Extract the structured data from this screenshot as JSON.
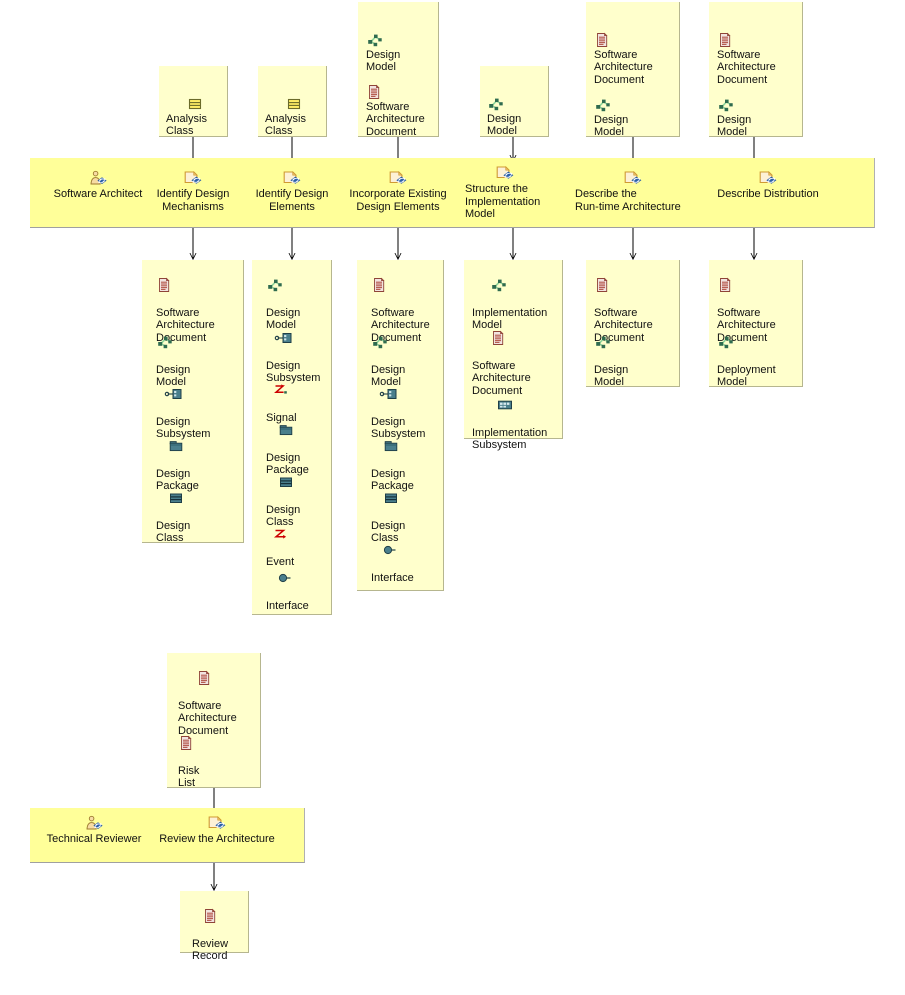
{
  "diagram": {
    "title": "Analysis & Design: Define a Candidate Architecture / Refine the Architecture (activity diagram)",
    "colors": {
      "band_fill": "#ffff99",
      "box_fill": "#ffffcc",
      "box_border": "#b6b68f",
      "connector": "#000000",
      "document_icon": "#c4756b",
      "model_icon": "#2f6b4f",
      "uml_teal": "#4a7f8c",
      "signal_red": "#cc0000",
      "task_tan": "#e8b96a",
      "role_blue": "#2a5fa8"
    },
    "roles": [
      {
        "id": "software-architect",
        "label": "Software Architect",
        "icon": "role-icon"
      },
      {
        "id": "technical-reviewer",
        "label": "Technical Reviewer",
        "icon": "role-icon"
      }
    ],
    "tasks": [
      {
        "id": "identify-design-mechanisms",
        "label": "Identify Design\nMechanisms",
        "icon": "task-icon"
      },
      {
        "id": "identify-design-elements",
        "label": "Identify Design\nElements",
        "icon": "task-icon"
      },
      {
        "id": "incorporate-existing-design-elements",
        "label": "Incorporate Existing\nDesign Elements",
        "icon": "task-icon"
      },
      {
        "id": "structure-the-implementation-model",
        "label": "Structure the\nImplementation\nModel",
        "icon": "task-icon"
      },
      {
        "id": "describe-the-run-time-architecture",
        "label": "Describe the\nRun-time Architecture",
        "icon": "task-icon"
      },
      {
        "id": "describe-distribution",
        "label": "Describe Distribution",
        "icon": "task-icon"
      },
      {
        "id": "review-the-architecture",
        "label": "Review the Architecture",
        "icon": "task-icon"
      }
    ],
    "input_boxes": [
      {
        "id": "input-identify-design-mechanisms",
        "artifacts": [
          {
            "icon": "analysis-class-icon",
            "label": "Analysis\nClass"
          }
        ]
      },
      {
        "id": "input-identify-design-elements",
        "artifacts": [
          {
            "icon": "analysis-class-icon",
            "label": "Analysis\nClass"
          }
        ]
      },
      {
        "id": "input-incorporate-existing-design-elements",
        "artifacts": [
          {
            "icon": "model-icon",
            "label": "Design\nModel"
          },
          {
            "icon": "document-icon",
            "label": "Software\nArchitecture\nDocument"
          }
        ]
      },
      {
        "id": "input-structure-the-implementation-model",
        "artifacts": [
          {
            "icon": "model-icon",
            "label": "Design\nModel"
          }
        ]
      },
      {
        "id": "input-describe-the-run-time-architecture",
        "artifacts": [
          {
            "icon": "document-icon",
            "label": "Software\nArchitecture\nDocument"
          },
          {
            "icon": "model-icon",
            "label": "Design\nModel"
          }
        ]
      },
      {
        "id": "input-describe-distribution",
        "artifacts": [
          {
            "icon": "document-icon",
            "label": "Software\nArchitecture\nDocument"
          },
          {
            "icon": "model-icon",
            "label": "Design\nModel"
          }
        ]
      },
      {
        "id": "input-review-the-architecture",
        "artifacts": [
          {
            "icon": "document-icon",
            "label": "Software\nArchitecture\nDocument"
          },
          {
            "icon": "document-icon",
            "label": "Risk\nList"
          }
        ]
      }
    ],
    "output_boxes": [
      {
        "id": "output-identify-design-mechanisms",
        "artifacts": [
          {
            "icon": "document-icon",
            "label": "Software\nArchitecture\nDocument"
          },
          {
            "icon": "model-icon",
            "label": "Design\nModel"
          },
          {
            "icon": "subsystem-icon",
            "label": "Design\nSubsystem"
          },
          {
            "icon": "package-icon",
            "label": "Design\nPackage"
          },
          {
            "icon": "class-icon",
            "label": "Design\nClass"
          }
        ]
      },
      {
        "id": "output-identify-design-elements",
        "artifacts": [
          {
            "icon": "model-icon",
            "label": "Design\nModel"
          },
          {
            "icon": "subsystem-icon",
            "label": "Design\nSubsystem"
          },
          {
            "icon": "signal-icon",
            "label": "Signal"
          },
          {
            "icon": "package-icon",
            "label": "Design\nPackage"
          },
          {
            "icon": "class-icon",
            "label": "Design\nClass"
          },
          {
            "icon": "event-icon",
            "label": "Event"
          },
          {
            "icon": "interface-icon",
            "label": "Interface"
          }
        ]
      },
      {
        "id": "output-incorporate-existing-design-elements",
        "artifacts": [
          {
            "icon": "document-icon",
            "label": "Software\nArchitecture\nDocument"
          },
          {
            "icon": "model-icon",
            "label": "Design\nModel"
          },
          {
            "icon": "subsystem-icon",
            "label": "Design\nSubsystem"
          },
          {
            "icon": "package-icon",
            "label": "Design\nPackage"
          },
          {
            "icon": "class-icon",
            "label": "Design\nClass"
          },
          {
            "icon": "interface-icon",
            "label": "Interface"
          }
        ]
      },
      {
        "id": "output-structure-the-implementation-model",
        "artifacts": [
          {
            "icon": "model-icon",
            "label": "Implementation\nModel"
          },
          {
            "icon": "document-icon",
            "label": "Software\nArchitecture\nDocument"
          },
          {
            "icon": "impl-subsystem-icon",
            "label": "Implementation\nSubsystem"
          }
        ]
      },
      {
        "id": "output-describe-the-run-time-architecture",
        "artifacts": [
          {
            "icon": "document-icon",
            "label": "Software\nArchitecture\nDocument"
          },
          {
            "icon": "model-icon",
            "label": "Design\nModel"
          }
        ]
      },
      {
        "id": "output-describe-distribution",
        "artifacts": [
          {
            "icon": "document-icon",
            "label": "Software\nArchitecture\nDocument"
          },
          {
            "icon": "model-icon",
            "label": "Deployment\nModel"
          }
        ]
      },
      {
        "id": "output-review-the-architecture",
        "artifacts": [
          {
            "icon": "document-icon",
            "label": "Review\nRecord"
          }
        ]
      }
    ]
  }
}
